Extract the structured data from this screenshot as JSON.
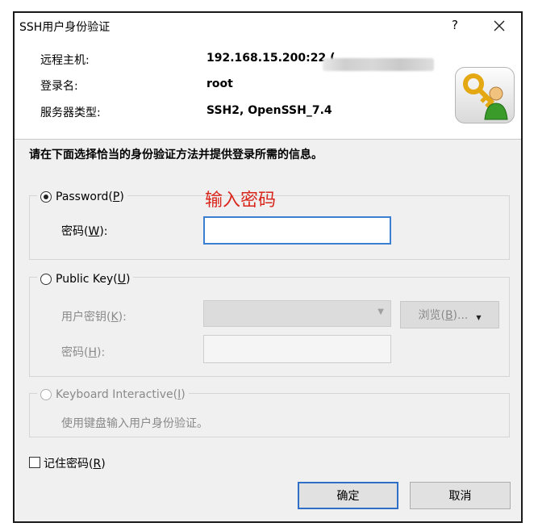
{
  "titlebar": {
    "title": "SSH用户身份验证",
    "help": "?"
  },
  "info": {
    "host_label": "远程主机:",
    "host_value": "192.168.15.200:22 (",
    "login_label": "登录名:",
    "login_value": "root",
    "server_type_label": "服务器类型:",
    "server_type_value": "SSH2, OpenSSH_7.4",
    "icon": "key-user-icon"
  },
  "instruction": "请在下面选择恰当的身份验证方法并提供登录所需的信息。",
  "annotation": "输入密码",
  "password_group": {
    "label_main": "Password(",
    "label_key": "P",
    "label_end": ")",
    "selected": true,
    "field_label_main": "密码(",
    "field_label_key": "W",
    "field_label_end": "):",
    "field_value": ""
  },
  "publickey_group": {
    "label_main": "Public Key(",
    "label_key": "U",
    "label_end": ")",
    "selected": false,
    "user_key_label_main": "用户密钥(",
    "user_key_label_key": "K",
    "user_key_label_end": "):",
    "browse_label_main": "浏览(",
    "browse_label_key": "B",
    "browse_label_end": ")...",
    "passphrase_label_main": "密码(",
    "passphrase_label_key": "H",
    "passphrase_label_end": "):"
  },
  "keyboard_group": {
    "label_main": "Keyboard Interactive(",
    "label_key": "I",
    "label_end": ")",
    "selected": false,
    "description": "使用键盘输入用户身份验证。"
  },
  "remember": {
    "label_main": "记住密码(",
    "label_key": "R",
    "label_end": ")",
    "checked": false
  },
  "buttons": {
    "ok": "确定",
    "cancel": "取消"
  }
}
